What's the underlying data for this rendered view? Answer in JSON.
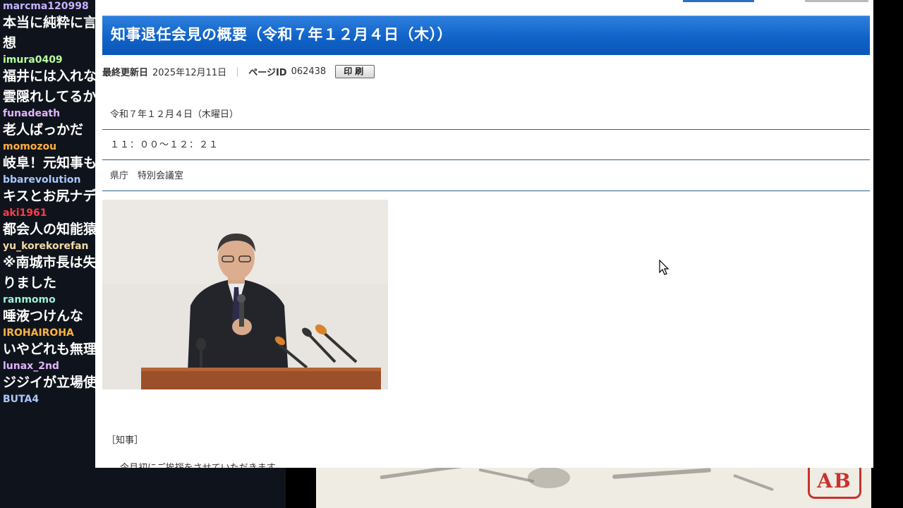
{
  "chat": {
    "messages": [
      {
        "user": "marcma120998",
        "user_color": "#c7b3ff",
        "text": "本当に純粋に言\n想"
      },
      {
        "user": "imura0409",
        "user_color": "#b7ff9e",
        "text": "福井には入れな\n雲隠れしてるか"
      },
      {
        "user": "funadeath",
        "user_color": "#e1b3ff",
        "text": "老人ばっかだ"
      },
      {
        "user": "momozou",
        "user_color": "#ffae3d",
        "text": "岐阜！元知事も"
      },
      {
        "user": "bbarevolution",
        "user_color": "#a9c7ff",
        "text": "キスとお尻ナデ"
      },
      {
        "user": "aki1961",
        "user_color": "#ff3b4a",
        "text": "都会人の知能猿"
      },
      {
        "user": "yu_korekorefan",
        "user_color": "#f5d9a6",
        "text": "※南城市長は失\nりました"
      },
      {
        "user": "ranmomo",
        "user_color": "#9ef0d8",
        "text": "唾液つけんな"
      },
      {
        "user": "IROHAIROHA",
        "user_color": "#ffb23d",
        "text": "いやどれも無理"
      },
      {
        "user": "lunax_2nd",
        "user_color": "#e1b3ff",
        "text": "ジジイが立場使って何してんだよ"
      },
      {
        "user": "BUTA4",
        "user_color": "#a9c7ff",
        "text": ""
      }
    ]
  },
  "page": {
    "title": "知事退任会見の概要（令和７年１２月４日（木））",
    "meta": {
      "updated_label": "最終更新日",
      "updated_value": "2025年12月11日",
      "separator": "｜",
      "page_id_label": "ページID",
      "page_id_value": "062438",
      "print_label": "印刷"
    },
    "rows": {
      "date": "令和７年１２月４日（木曜日）",
      "time": "１１：００～１２：２１",
      "place": "県庁　特別会議室"
    },
    "section_label": "［知事］",
    "cut_text": "　今月初にご挨拶をさせていただきます"
  },
  "art": {
    "seal_text": "AB"
  },
  "colors": {
    "heading_blue": "#1063c9",
    "rule_blue": "#2a5f97",
    "chat_bg": "#0f141c"
  }
}
